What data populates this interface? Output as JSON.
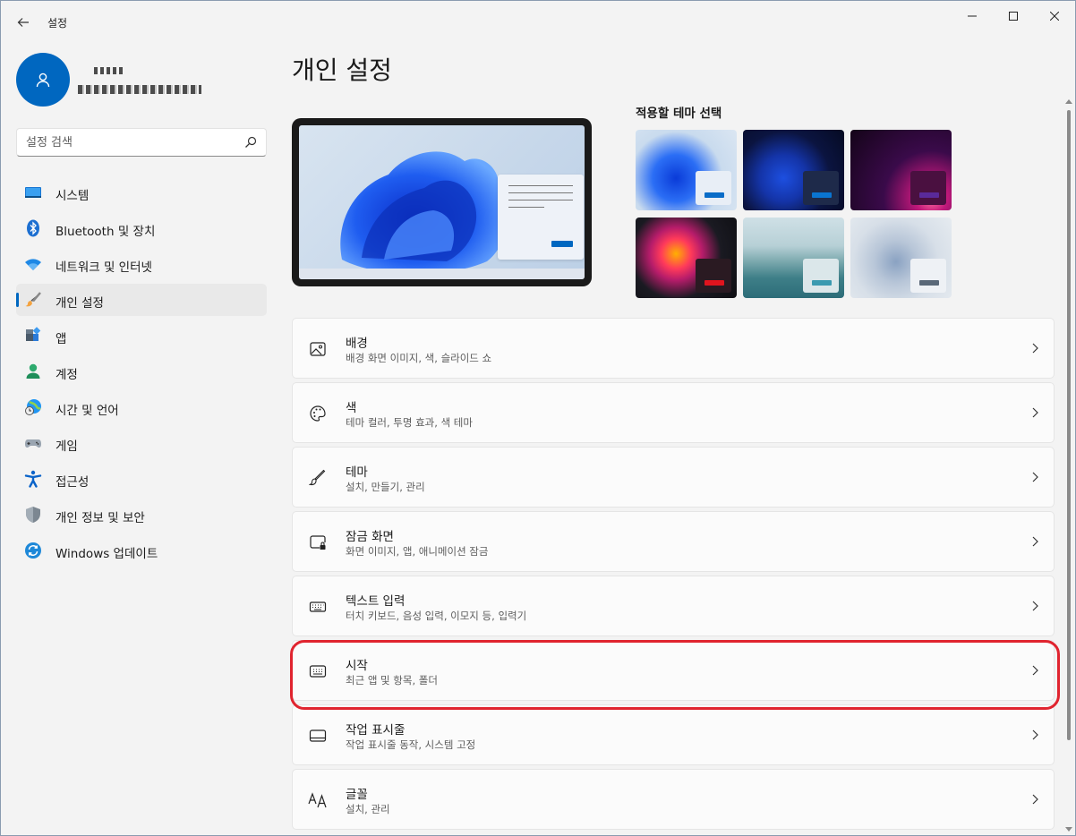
{
  "window": {
    "title": "설정"
  },
  "search": {
    "placeholder": "설정 검색"
  },
  "nav": {
    "items": [
      {
        "label": "시스템",
        "icon": "system-icon"
      },
      {
        "label": "Bluetooth 및 장치",
        "icon": "bluetooth-icon"
      },
      {
        "label": "네트워크 및 인터넷",
        "icon": "wifi-icon"
      },
      {
        "label": "개인 설정",
        "icon": "brush-icon",
        "selected": true
      },
      {
        "label": "앱",
        "icon": "apps-icon"
      },
      {
        "label": "계정",
        "icon": "account-icon"
      },
      {
        "label": "시간 및 언어",
        "icon": "globe-clock-icon"
      },
      {
        "label": "게임",
        "icon": "gamepad-icon"
      },
      {
        "label": "접근성",
        "icon": "accessibility-icon"
      },
      {
        "label": "개인 정보 및 보안",
        "icon": "shield-icon"
      },
      {
        "label": "Windows 업데이트",
        "icon": "update-icon"
      }
    ]
  },
  "main": {
    "title": "개인 설정",
    "theme_heading": "적용할 테마 선택",
    "settings": [
      {
        "title": "배경",
        "subtitle": "배경 화면 이미지, 색, 슬라이드 쇼",
        "icon": "picture-icon"
      },
      {
        "title": "색",
        "subtitle": "테마 컬러, 투명 효과, 색 테마",
        "icon": "palette-icon"
      },
      {
        "title": "테마",
        "subtitle": "설치, 만들기, 관리",
        "icon": "brush-icon"
      },
      {
        "title": "잠금 화면",
        "subtitle": "화면 이미지, 앱, 애니메이션 잠금",
        "icon": "lock-screen-icon"
      },
      {
        "title": "텍스트 입력",
        "subtitle": "터치 키보드, 음성 입력, 이모지 등, 입력기",
        "icon": "keyboard-icon"
      },
      {
        "title": "시작",
        "subtitle": "최근 앱 및 항목, 폴더",
        "icon": "start-menu-icon",
        "highlighted": true
      },
      {
        "title": "작업 표시줄",
        "subtitle": "작업 표시줄 동작, 시스템 고정",
        "icon": "taskbar-icon"
      },
      {
        "title": "글꼴",
        "subtitle": "설치, 관리",
        "icon": "font-icon"
      }
    ]
  },
  "colors": {
    "accent": "#0067c0",
    "highlight": "#e0242f"
  }
}
